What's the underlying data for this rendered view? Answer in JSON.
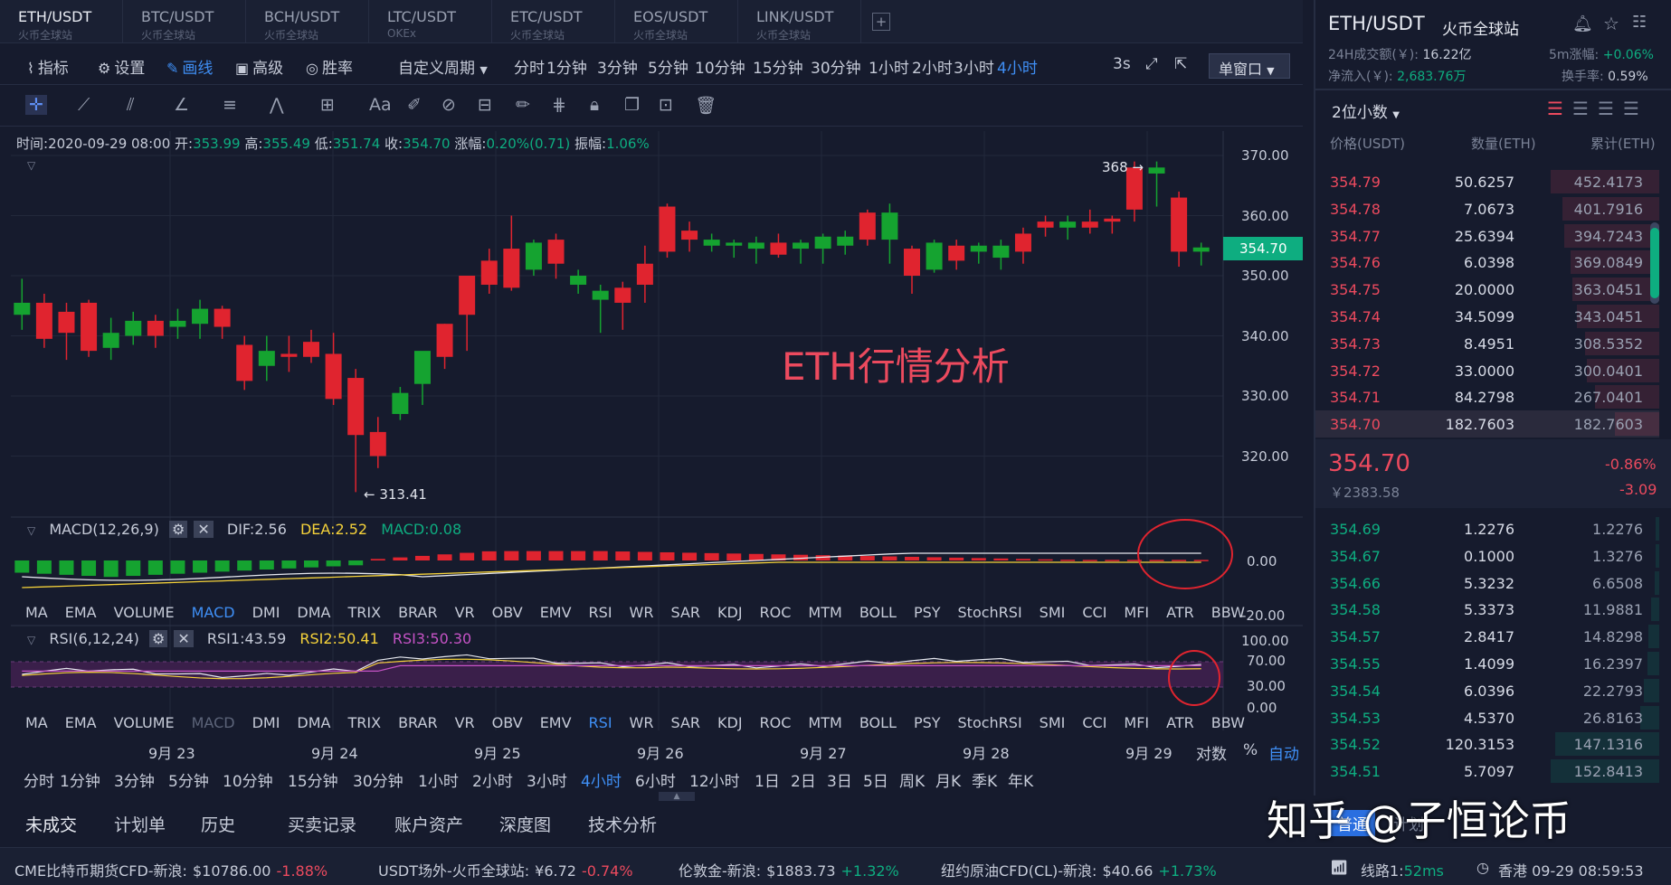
{
  "tabs": [
    {
      "sym": "ETH/USDT",
      "sub": "火币全球站"
    },
    {
      "sym": "BTC/USDT",
      "sub": "火币全球站"
    },
    {
      "sym": "BCH/USDT",
      "sub": "火币全球站"
    },
    {
      "sym": "LTC/USDT",
      "sub": "OKEx"
    },
    {
      "sym": "ETC/USDT",
      "sub": "火币全球站"
    },
    {
      "sym": "EOS/USDT",
      "sub": "火币全球站"
    },
    {
      "sym": "LINK/USDT",
      "sub": "火币全球站"
    }
  ],
  "tab_add": "+",
  "toolbar": {
    "indicators": "指标",
    "settings": "设置",
    "draw": "画线",
    "advanced": "高级",
    "winrate": "胜率",
    "custom_period": "自定义周期",
    "periods": [
      "分时",
      "1分钟",
      "3分钟",
      "5分钟",
      "10分钟",
      "15分钟",
      "30分钟",
      "1小时",
      "2小时",
      "3小时",
      "4小时"
    ],
    "active_period": "4小时",
    "three_s": "3s",
    "window": "单窗口"
  },
  "info": {
    "time_label": "时间:",
    "time": "2020-09-29 08:00",
    "open_label": "开:",
    "open": "353.99",
    "high_label": "高:",
    "high": "355.49",
    "low_label": "低:",
    "low": "351.74",
    "close_label": "收:",
    "close": "354.70",
    "chg_label": "涨幅:",
    "chg": "0.20%(0.71)",
    "amp_label": "振幅:",
    "amp": "1.06%"
  },
  "price_axis": [
    "370.00",
    "360.00",
    "350.00",
    "340.00",
    "330.00",
    "320.00"
  ],
  "current_price_tag": "354.70",
  "high_marker": "368 →",
  "low_marker": "← 313.41",
  "watermark": "ETH行情分析",
  "macd": {
    "title": "MACD(12,26,9)",
    "dif": "DIF:2.56",
    "dea": "DEA:2.52",
    "macd": "MACD:0.08",
    "axis": [
      "0.00",
      "-20.00"
    ]
  },
  "rsi": {
    "title": "RSI(6,12,24)",
    "rsi1": "RSI1:43.59",
    "rsi2": "RSI2:50.41",
    "rsi3": "RSI3:50.30",
    "axis": [
      "100.00",
      "70.00",
      "30.00",
      "0.00"
    ]
  },
  "ind_list": [
    "MA",
    "EMA",
    "VOLUME",
    "MACD",
    "DMI",
    "DMA",
    "TRIX",
    "BRAR",
    "VR",
    "OBV",
    "EMV",
    "RSI",
    "WR",
    "SAR",
    "KDJ",
    "ROC",
    "MTM",
    "BOLL",
    "PSY",
    "StochRSI",
    "SMI",
    "CCI",
    "MFI",
    "ATR",
    "BBW"
  ],
  "dates": [
    "9月 23",
    "9月 24",
    "9月 25",
    "9月 26",
    "9月 27",
    "9月 28",
    "9月 29"
  ],
  "axis_opts": {
    "log": "对数",
    "pct": "%",
    "auto": "自动"
  },
  "bottom_periods": [
    "分时",
    "1分钟",
    "3分钟",
    "5分钟",
    "10分钟",
    "15分钟",
    "30分钟",
    "1小时",
    "2小时",
    "3小时",
    "4小时",
    "6小时",
    "12小时",
    "1日",
    "2日",
    "3日",
    "5日",
    "周K",
    "月K",
    "季K",
    "年K"
  ],
  "bottom_tabs": [
    "未成交",
    "计划单",
    "历史",
    "买卖记录",
    "账户资产",
    "深度图",
    "技术分析"
  ],
  "right": {
    "pair": "ETH/USDT",
    "exchange": "火币全球站",
    "vol_label": "24H成交额(￥):",
    "vol": "16.22亿",
    "m5_label": "5m涨幅:",
    "m5": "+0.06%",
    "net_label": "净流入(￥):",
    "net": "2,683.76万",
    "turn_label": "换手率:",
    "turn": "0.59%",
    "decimals": "2位小数",
    "col_price": "价格(USDT)",
    "col_qty": "数量(ETH)",
    "col_cum": "累计(ETH)",
    "asks": [
      [
        "354.79",
        "50.6257",
        "452.4173"
      ],
      [
        "354.78",
        "7.0673",
        "401.7916"
      ],
      [
        "354.77",
        "25.6394",
        "394.7243"
      ],
      [
        "354.76",
        "6.0398",
        "369.0849"
      ],
      [
        "354.75",
        "20.0000",
        "363.0451"
      ],
      [
        "354.74",
        "34.5099",
        "343.0451"
      ],
      [
        "354.73",
        "8.4951",
        "308.5352"
      ],
      [
        "354.72",
        "33.0000",
        "300.0401"
      ],
      [
        "354.71",
        "84.2798",
        "267.0401"
      ],
      [
        "354.70",
        "182.7603",
        "182.7603"
      ]
    ],
    "last": "354.70",
    "last_cny": "￥2383.58",
    "last_pct": "-0.86%",
    "last_chg": "-3.09",
    "bids": [
      [
        "354.69",
        "1.2276",
        "1.2276"
      ],
      [
        "354.67",
        "0.1000",
        "1.3276"
      ],
      [
        "354.66",
        "5.3232",
        "6.6508"
      ],
      [
        "354.58",
        "5.3373",
        "11.9881"
      ],
      [
        "354.57",
        "2.8417",
        "14.8298"
      ],
      [
        "354.55",
        "1.4099",
        "16.2397"
      ],
      [
        "354.54",
        "6.0396",
        "22.2793"
      ],
      [
        "354.53",
        "4.5370",
        "26.8163"
      ],
      [
        "354.52",
        "120.3153",
        "147.1316"
      ],
      [
        "354.51",
        "5.7097",
        "152.8413"
      ]
    ],
    "order_tabs": [
      "普通",
      "计划"
    ],
    "zhihu": "知乎 @子恒论币"
  },
  "ticker": [
    {
      "name": "CME比特币期货CFD-新浪:",
      "price": "$10786.00",
      "chg": "-1.88%",
      "dir": "down"
    },
    {
      "name": "USDT场外-火币全球站:",
      "price": "¥6.72",
      "chg": "-0.74%",
      "dir": "down"
    },
    {
      "name": "伦敦金-新浪:",
      "price": "$1883.73",
      "chg": "+1.32%",
      "dir": "up"
    },
    {
      "name": "纽约原油CFD(CL)-新浪:",
      "price": "$40.66",
      "chg": "+1.73%",
      "dir": "up"
    }
  ],
  "status": {
    "line": "线路1:",
    "ms": "52ms",
    "region": "香港 09-29 08:59:53"
  },
  "chart_data": {
    "type": "candlestick",
    "price_range": [
      313,
      370
    ],
    "candles": [
      [
        343.5,
        345.5,
        341,
        349.5
      ],
      [
        345.5,
        339.5,
        338,
        347
      ],
      [
        344,
        340.5,
        336,
        345.5
      ],
      [
        345.5,
        337.5,
        336.5,
        346
      ],
      [
        338,
        340.5,
        336,
        343
      ],
      [
        340,
        342.5,
        338.5,
        344
      ],
      [
        342.5,
        340,
        338,
        343.5
      ],
      [
        341.5,
        342.5,
        339.5,
        344.5
      ],
      [
        342,
        344.5,
        339.5,
        346
      ],
      [
        344.5,
        341.5,
        339.5,
        345
      ],
      [
        338.5,
        332.5,
        331,
        340
      ],
      [
        335,
        337.5,
        332.5,
        340
      ],
      [
        337,
        336.5,
        334,
        340
      ],
      [
        339,
        336.5,
        335.5,
        341
      ],
      [
        337,
        329.5,
        328.5,
        340.5
      ],
      [
        333,
        323.5,
        314,
        334.5
      ],
      [
        324,
        320,
        318,
        326.5
      ],
      [
        327,
        330.5,
        326,
        331.5
      ],
      [
        332,
        337.5,
        328.5,
        333.5
      ],
      [
        342,
        336.5,
        334.5,
        342
      ],
      [
        350,
        343.5,
        337.5,
        350
      ],
      [
        352.5,
        348.5,
        347,
        354.5
      ],
      [
        354.5,
        348,
        347.5,
        360
      ],
      [
        351,
        355.5,
        350,
        356
      ],
      [
        356,
        352,
        349.5,
        357
      ],
      [
        348.5,
        350,
        347,
        351
      ],
      [
        346,
        347.5,
        340.5,
        348.5
      ],
      [
        348,
        345.5,
        341,
        349
      ],
      [
        352,
        348.5,
        345.5,
        355
      ],
      [
        361.5,
        354,
        353,
        362
      ],
      [
        357.5,
        356,
        354,
        359
      ],
      [
        355,
        356,
        354,
        357
      ],
      [
        355,
        355.5,
        353,
        356
      ],
      [
        354.5,
        355.5,
        352,
        356.5
      ],
      [
        355.5,
        353.5,
        353,
        357
      ],
      [
        354.5,
        355.5,
        352,
        356
      ],
      [
        354.5,
        356.5,
        352,
        357
      ],
      [
        355,
        356.5,
        353.5,
        357.5
      ],
      [
        360.5,
        356,
        355,
        361
      ],
      [
        356,
        360.5,
        352,
        362
      ],
      [
        354.5,
        350,
        347,
        355
      ],
      [
        351,
        355.5,
        350.5,
        356
      ],
      [
        355,
        352.5,
        351,
        356
      ],
      [
        354,
        355,
        352,
        355.5
      ],
      [
        353,
        355,
        351,
        356
      ],
      [
        357,
        354,
        352,
        358
      ],
      [
        359,
        358,
        356.5,
        360
      ],
      [
        358,
        359,
        356,
        360
      ],
      [
        359,
        358,
        357,
        361
      ],
      [
        359.5,
        359,
        357,
        360
      ],
      [
        368,
        361,
        359,
        369
      ],
      [
        367,
        368,
        361.5,
        369
      ],
      [
        363,
        354,
        351.5,
        364
      ],
      [
        354,
        354.7,
        351.7,
        355.5
      ]
    ]
  }
}
